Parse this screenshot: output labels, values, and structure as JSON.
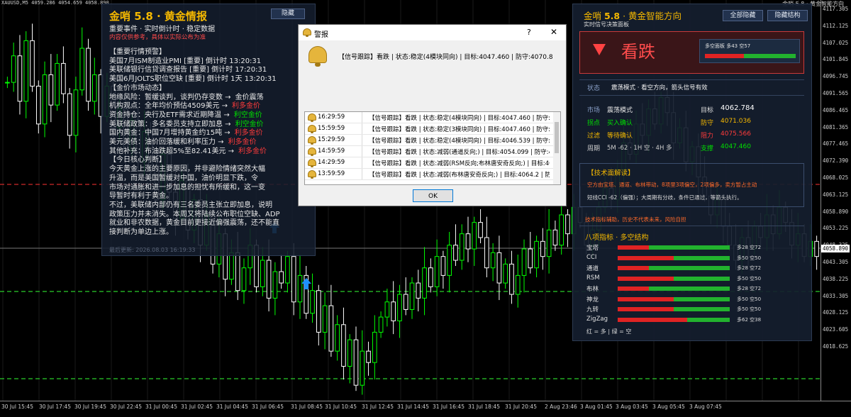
{
  "top_bar": {
    "ohlc": "XAUUSD,M5  4059.286 4054.659 4058.890",
    "title_right": "金哨 5.8 · 黄金智能方向"
  },
  "price_axis": {
    "ticks": [
      "4117.305",
      "4112.125",
      "4107.025",
      "4101.845",
      "4096.745",
      "4091.565",
      "4086.465",
      "4081.365",
      "4077.465",
      "4072.390",
      "4068.025",
      "4063.125",
      "4058.890",
      "4053.225",
      "4048.325",
      "4043.305",
      "4038.225",
      "4033.305",
      "4028.125",
      "4023.605",
      "4018.625"
    ],
    "current_price": "4058.890"
  },
  "time_axis": {
    "ticks": [
      "30 Jul 15:45",
      "30 Jul 17:45",
      "30 Jul 19:45",
      "30 Jul 22:45",
      "31 Jul 00:45",
      "31 Jul 02:45",
      "31 Jul 04:45",
      "31 Jul 06:45",
      "31 Jul 08:45",
      "31 Jul 10:45",
      "31 Jul 12:45",
      "31 Jul 14:45",
      "31 Jul 16:45",
      "31 Jul 18:45",
      "31 Jul 20:45",
      "2 Aug 23:46",
      "3 Aug 01:45",
      "3 Aug 03:45",
      "3 Aug 05:45",
      "3 Aug 07:45"
    ]
  },
  "chart_data": {
    "type": "candlestick",
    "symbol": "XAUUSD",
    "timeframe": "M5",
    "ylim": [
      4018.6,
      4122.0
    ],
    "bull_color": "#00ff00",
    "bear_color": "#ffffff",
    "close_series": [
      4101,
      4108,
      4096,
      4112,
      4100,
      4090,
      4103,
      4095,
      4106,
      4098,
      4087,
      4099,
      4110,
      4096,
      4103,
      4092,
      4100,
      4089,
      4094,
      4083,
      4091,
      4080,
      4088,
      4078,
      4070,
      4082,
      4072,
      4065,
      4075,
      4062,
      4070,
      4058,
      4066,
      4053,
      4061,
      4049,
      4056,
      4046,
      4052,
      4058,
      4047,
      4054,
      4044,
      4051,
      4048,
      4055,
      4043,
      4050,
      4040,
      4046,
      4035,
      4042,
      4030,
      4037,
      4026,
      4033,
      4021,
      4030,
      4027,
      4035,
      4039,
      4043,
      4038,
      4045,
      4041,
      4048,
      4044,
      4052,
      4047,
      4055,
      4050,
      4058,
      4054,
      4061,
      4057,
      4064,
      4060,
      4052,
      4056,
      4048,
      4053,
      4045,
      4050,
      4057,
      4052,
      4059,
      4055,
      4062,
      4058,
      4066,
      4061,
      4068,
      4064,
      4058,
      4062,
      4068,
      4073,
      4070,
      4078,
      4085,
      4082,
      4090,
      4087,
      4094,
      4090,
      4097,
      4093,
      4085,
      4089,
      4080,
      4084,
      4076,
      4071,
      4066,
      4070,
      4063,
      4058,
      4054,
      4060,
      4057,
      4063,
      4060,
      4066,
      4061,
      4068,
      4064,
      4058,
      4061,
      4055,
      4059,
      4055
    ]
  },
  "left_panel": {
    "title": "金哨 5.8 · 黄金情报",
    "sub1": "重要事件 · 实时倒计时 · 稳定数据",
    "sub2": "内容仅供参考，具体以实际公布为准",
    "hide_btn": "隐藏",
    "lines": [
      {
        "t": "【重要行情预警】",
        "c": "w"
      },
      {
        "t": "美国7月ISM制造业PMI [重要] 倒计时 13:20:31",
        "c": "w"
      },
      {
        "t": "美联储银行信贷调查报告 [重要] 倒计时 17:20:31",
        "c": "w"
      },
      {
        "t": "美国6月JOLTS职位空缺 [重要] 倒计时 1天 13:20:31",
        "c": "w"
      },
      {
        "t": "【金价市场动态】",
        "c": "w"
      },
      {
        "t": "地缘风险：暂缓谈判，谈判仍存变数 →",
        "a": "金价震荡",
        "ac": "w"
      },
      {
        "t": "机构观点：全年均价预估4509美元 →",
        "a": "利多金价",
        "ac": "r"
      },
      {
        "t": "资金持仓：央行及ETF需求近期降温 →",
        "a": "利空金价",
        "ac": "g"
      },
      {
        "t": "美联储政策：多名委员支持立即加息 →",
        "a": "利空金价",
        "ac": "g"
      },
      {
        "t": "国内黄金：中国7月增持黄金约15吨 →",
        "a": "利多金价",
        "ac": "r"
      },
      {
        "t": "美元美债：油价回落缓和利率压力 →",
        "a": "利多金价",
        "ac": "r"
      },
      {
        "t": "其他补充：布油跌超5%至82.41美元 →",
        "a": "利多金价",
        "ac": "r"
      },
      {
        "t": "【今日核心判断】",
        "c": "w"
      },
      {
        "t": "今天黄金上涨的主要原因，并非避险情绪突然大幅",
        "c": "w"
      },
      {
        "t": "升温，而是美国暂缓对中国，油价明显下跌，令",
        "c": "w"
      },
      {
        "t": "市场对通胀和进一步加息的担忧有所缓和，这一变",
        "c": "w"
      },
      {
        "t": "导暂时有利于黄金。",
        "c": "w"
      },
      {
        "t": "不过，美联储内部仍有三名委员主张立即加息，说明",
        "c": "w"
      },
      {
        "t": "政策压力并未消失。本周又将陆续公布职位空缺、ADP",
        "c": "w"
      },
      {
        "t": "就业和非农数据，黄金目前更接近偏强震荡，还不能直",
        "c": "w"
      },
      {
        "t": "接判断为单边上涨。",
        "c": "w"
      }
    ],
    "update": "最后更新: 2026.08.03 16:19:33"
  },
  "dialog": {
    "title": "警报",
    "help": "?",
    "close": "✕",
    "message": "【信号跟踪】看跌 | 状态:稳定(4模块同向) | 目标:4047.460 | 防守:4070.8",
    "rows": [
      {
        "time": "16:29:59",
        "text": "【信号跟踪】看跌 | 状态:稳定(4模块同向) | 目标:4047.460 | 防守:4070.8"
      },
      {
        "time": "15:59:59",
        "text": "【信号跟踪】看跌 | 状态:稳定(3模块同向) | 目标:4047.460 | 防守:4070.8"
      },
      {
        "time": "15:29:59",
        "text": "【信号跟踪】看跌 | 状态:稳定(4模块同向) | 目标:4046.539 | 防守:4071.0"
      },
      {
        "time": "14:59:59",
        "text": "【信号跟踪】看跌 | 状态:减弱(通道反向;) | 目标:4054.099 | 防守:4073.2"
      },
      {
        "time": "14:29:59",
        "text": "【信号跟踪】看跌 | 状态:减弱(RSM反向;布林唐安奇反向;) | 目标:4052.1"
      },
      {
        "time": "13:59:59",
        "text": "【信号跟踪】看跌 | 状态:减弱(布林唐安奇反向;) | 目标:4064.2 | 防守:4079.1"
      }
    ],
    "ok": "OK"
  },
  "right_panel": {
    "title_prefix": "金哨 ",
    "version": "5.8",
    "title_suffix": " · 黄金智能方向",
    "sub": "实时信号决策面板",
    "btn_hide_all": "全部隐藏",
    "btn_hide_struct": "隐藏结构",
    "signal": "看跌",
    "mini_title": "多空面板  多43 空57",
    "bull_pct": 43,
    "status_label": "状态",
    "status_text": "震荡模式 · 看空方向，箭头信号有效",
    "market_label": "市场",
    "market_val": "震荡模式",
    "target_label": "目标",
    "target_val": "4062.784",
    "pivot_label": "拐点",
    "pivot_val": "买入确认",
    "defense_label": "防守",
    "defense_val": "4071.036",
    "filter_label": "过滤",
    "filter_val": "等待确认",
    "resist_label": "阻力",
    "resist_val": "4075.566",
    "period_label": "周期",
    "period_val": "5M -62 · 1H 空 · 4H 多",
    "support_label": "支撑",
    "support_val": "4047.460",
    "tech_title": "【技术面解读】",
    "tech_line1": "空方由宝塔、通道、布林带动，8项里3项偏空，2项偏多，卖方暂占主动",
    "tech_line2": "短线CCI -62（偏强）；大周期有分歧，条件已通过，等箭头执行。",
    "warn": "技术指标辅助，历史不代表未来，风险自担",
    "eight_title": "八项指标 · 多空结构",
    "indicators": [
      {
        "name": "宝塔",
        "bull": 28,
        "text": "多28 空72"
      },
      {
        "name": "CCI",
        "bull": 50,
        "text": "多50 空50"
      },
      {
        "name": "通道",
        "bull": 28,
        "text": "多28 空72"
      },
      {
        "name": "RSM",
        "bull": 50,
        "text": "多50 空50"
      },
      {
        "name": "布林",
        "bull": 28,
        "text": "多28 空72"
      },
      {
        "name": "神龙",
        "bull": 50,
        "text": "多50 空50"
      },
      {
        "name": "九转",
        "bull": 50,
        "text": "多50 空50"
      },
      {
        "name": "ZigZag",
        "bull": 62,
        "text": "多62 空38"
      }
    ],
    "legend": "红 = 多  |  绿 = 空"
  },
  "colors": {
    "bull": "#00ff00",
    "bear": "#ffffff",
    "accent": "#f5b800",
    "red": "#ff3b3b",
    "green": "#00e000"
  }
}
